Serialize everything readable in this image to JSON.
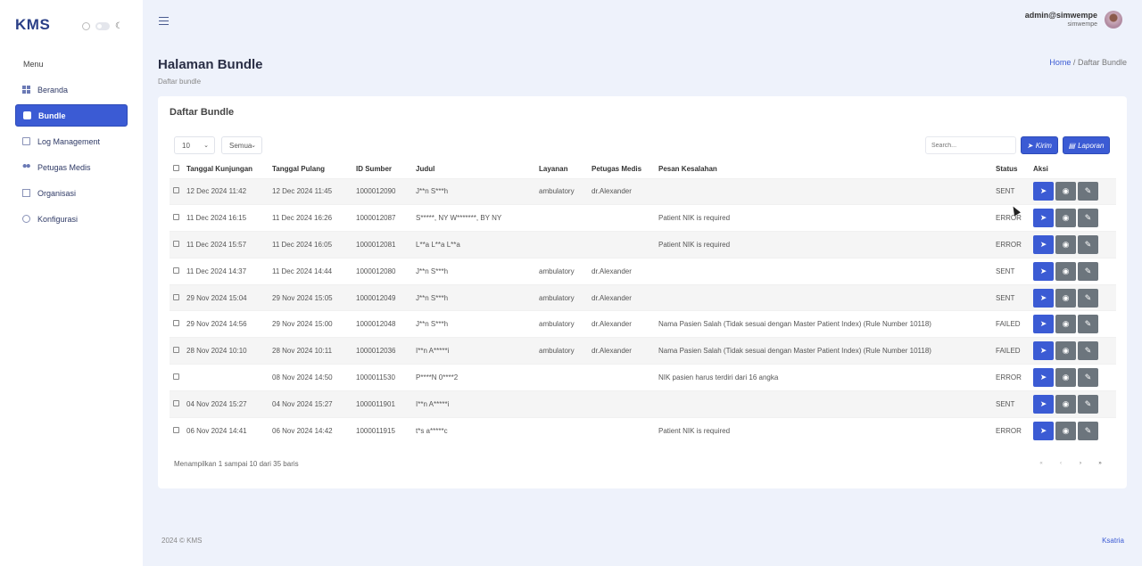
{
  "brand": "KMS",
  "sidebar": {
    "menu_label": "Menu",
    "items": [
      {
        "label": "Beranda",
        "icon": "dashboard-icon"
      },
      {
        "label": "Bundle",
        "icon": "bag-icon",
        "active": true
      },
      {
        "label": "Log Management",
        "icon": "log-icon"
      },
      {
        "label": "Petugas Medis",
        "icon": "users-icon"
      },
      {
        "label": "Organisasi",
        "icon": "building-icon"
      },
      {
        "label": "Konfigurasi",
        "icon": "gear-icon"
      }
    ]
  },
  "header": {
    "user_name": "admin@simwempe",
    "user_sub": "simwempe"
  },
  "page": {
    "title": "Halaman Bundle",
    "subtitle": "Daftar bundle",
    "breadcrumb_home": "Home",
    "breadcrumb_sep": "/",
    "breadcrumb_current": "Daftar Bundle"
  },
  "card": {
    "title": "Daftar Bundle",
    "page_size": "10",
    "filter": "Semua",
    "search_placeholder": "Search...",
    "kirim_label": "Kirim",
    "laporan_label": "Laporan",
    "columns": [
      "Tanggal Kunjungan",
      "Tanggal Pulang",
      "ID Sumber",
      "Judul",
      "Layanan",
      "Petugas Medis",
      "Pesan Kesalahan",
      "Status",
      "Aksi"
    ],
    "rows": [
      {
        "kunjungan": "12 Dec 2024 11:42",
        "pulang": "12 Dec 2024 11:45",
        "id": "1000012090",
        "judul": "J**n S***h",
        "layanan": "ambulatory",
        "petugas": "dr.Alexander",
        "pesan": "",
        "status": "SENT"
      },
      {
        "kunjungan": "11 Dec 2024 16:15",
        "pulang": "11 Dec 2024 16:26",
        "id": "1000012087",
        "judul": "S*****, NY W*******, BY NY",
        "layanan": "",
        "petugas": "",
        "pesan": "Patient NIK is required",
        "status": "ERROR"
      },
      {
        "kunjungan": "11 Dec 2024 15:57",
        "pulang": "11 Dec 2024 16:05",
        "id": "1000012081",
        "judul": "L**a L**a L**a",
        "layanan": "",
        "petugas": "",
        "pesan": "Patient NIK is required",
        "status": "ERROR"
      },
      {
        "kunjungan": "11 Dec 2024 14:37",
        "pulang": "11 Dec 2024 14:44",
        "id": "1000012080",
        "judul": "J**n S***h",
        "layanan": "ambulatory",
        "petugas": "dr.Alexander",
        "pesan": "",
        "status": "SENT"
      },
      {
        "kunjungan": "29 Nov 2024 15:04",
        "pulang": "29 Nov 2024 15:05",
        "id": "1000012049",
        "judul": "J**n S***h",
        "layanan": "ambulatory",
        "petugas": "dr.Alexander",
        "pesan": "",
        "status": "SENT"
      },
      {
        "kunjungan": "29 Nov 2024 14:56",
        "pulang": "29 Nov 2024 15:00",
        "id": "1000012048",
        "judul": "J**n S***h",
        "layanan": "ambulatory",
        "petugas": "dr.Alexander",
        "pesan": "Nama Pasien Salah (Tidak sesuai dengan Master Patient Index) (Rule Number 10118)",
        "status": "FAILED"
      },
      {
        "kunjungan": "28 Nov 2024 10:10",
        "pulang": "28 Nov 2024 10:11",
        "id": "1000012036",
        "judul": "I**n A*****i",
        "layanan": "ambulatory",
        "petugas": "dr.Alexander",
        "pesan": "Nama Pasien Salah (Tidak sesuai dengan Master Patient Index) (Rule Number 10118)",
        "status": "FAILED"
      },
      {
        "kunjungan": "",
        "pulang": "08 Nov 2024 14:50",
        "id": "1000011530",
        "judul": "P****N 0****2",
        "layanan": "",
        "petugas": "",
        "pesan": "NIK pasien harus terdiri dari 16 angka",
        "status": "ERROR"
      },
      {
        "kunjungan": "04 Nov 2024 15:27",
        "pulang": "04 Nov 2024 15:27",
        "id": "1000011901",
        "judul": "I**n A*****i",
        "layanan": "",
        "petugas": "",
        "pesan": "",
        "status": "SENT"
      },
      {
        "kunjungan": "06 Nov 2024 14:41",
        "pulang": "06 Nov 2024 14:42",
        "id": "1000011915",
        "judul": "t*s a*****c",
        "layanan": "",
        "petugas": "",
        "pesan": "Patient NIK is required",
        "status": "ERROR"
      }
    ],
    "info": "Menampilkan 1 sampai 10 dari 35 baris",
    "pager": [
      "«",
      "‹",
      "›",
      "»"
    ]
  },
  "footer": {
    "copyright": "2024 © KMS",
    "author": "Ksatria"
  },
  "colors": {
    "accent": "#3b5bd4",
    "background": "#eef2fb",
    "secondary": "#6c757d"
  }
}
